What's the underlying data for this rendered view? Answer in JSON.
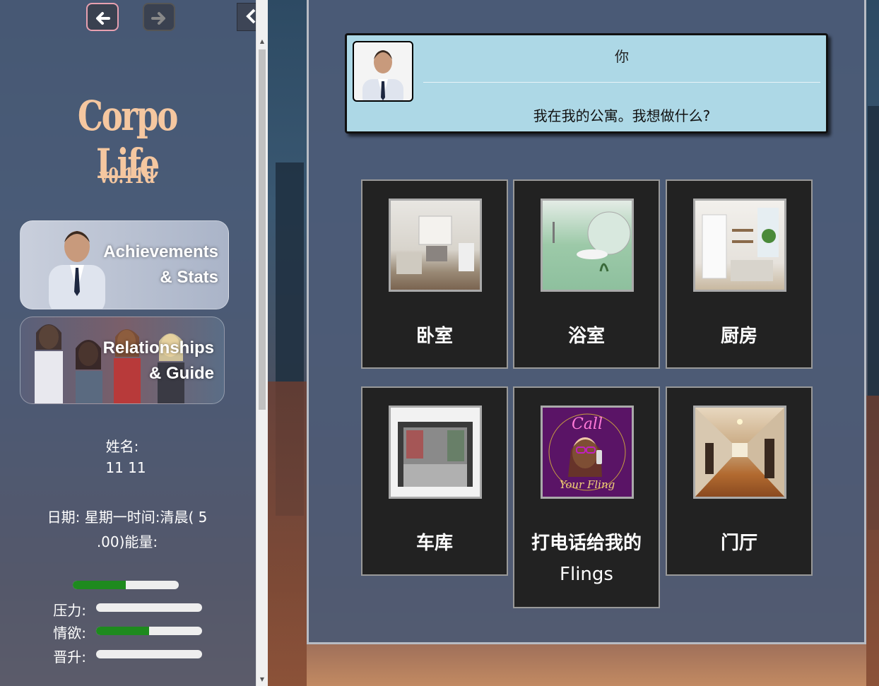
{
  "nav": {
    "back_icon": "arrow-left-icon",
    "forward_icon": "arrow-right-icon",
    "collapse_icon": "chevron-left-icon"
  },
  "sidebar": {
    "logo": "Corpo Life",
    "version": "v0.11d",
    "achievements_line1": "Achievements",
    "achievements_line2": "& Stats",
    "relationships_line1": "Relationships",
    "relationships_line2": "& Guide",
    "name_label": "姓名:",
    "name_value": "11 11",
    "date_line1": "日期:  星期一时间:清晨( 5",
    "date_line2": ".00)能量:",
    "energy": 0.5,
    "stats": [
      {
        "label": "压力:",
        "value": 0.0
      },
      {
        "label": "情欲:",
        "value": 0.5
      },
      {
        "label": "晋升:",
        "value": 0.0
      }
    ]
  },
  "dialog": {
    "speaker": "你",
    "text": "我在我的公寓。我想做什么?"
  },
  "locations": [
    {
      "name": "卧室",
      "icon": "bedroom-photo"
    },
    {
      "name": "浴室",
      "icon": "bathroom-photo"
    },
    {
      "name": "厨房",
      "icon": "kitchen-photo"
    },
    {
      "name": "车库",
      "icon": "garage-photo"
    },
    {
      "name": "打电话给我的",
      "name2": "Flings",
      "icon": "call-your-fling-photo",
      "thumb_text1": "Call",
      "thumb_text2": "Your Fling"
    },
    {
      "name": "门厅",
      "icon": "hallway-photo"
    }
  ],
  "colors": {
    "energy_fill": "#1e8a1e",
    "dialog_bg": "#add8e6",
    "tile_bg": "#222222",
    "logo": "#f5c7a0"
  }
}
